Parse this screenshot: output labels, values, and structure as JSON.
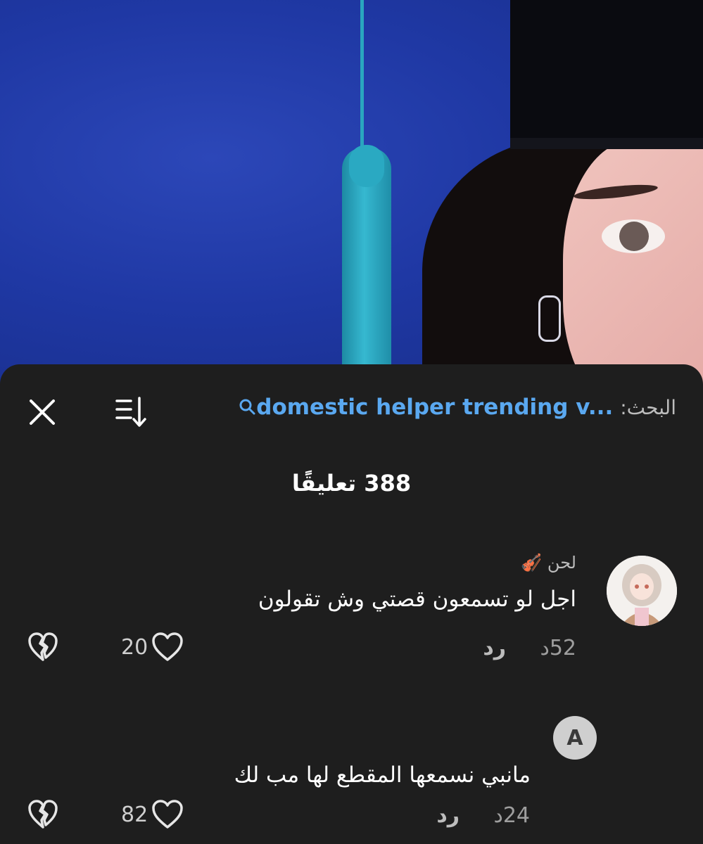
{
  "search": {
    "label": "البحث:",
    "term": "domestic helper trending v..."
  },
  "comments_count": "388 تعليقًا",
  "comments": [
    {
      "username": "لحن 🎻",
      "text": "اجل لو تسمعون قصتي وش تقولون",
      "age": "52د",
      "reply_label": "رد",
      "likes": "20",
      "avatar_type": "illustration"
    },
    {
      "avatar_letter": "A",
      "text": "مانبي نسمعها المقطع لها مب لك",
      "age": "24د",
      "reply_label": "رد",
      "likes": "82"
    }
  ],
  "icons": {
    "close": "close-icon",
    "sort": "sort-icon",
    "search": "search-icon",
    "like": "heart-icon",
    "dislike": "broken-heart-icon"
  },
  "colors": {
    "sheet_bg": "#1e1e1e",
    "link_blue": "#5aa8f0"
  }
}
